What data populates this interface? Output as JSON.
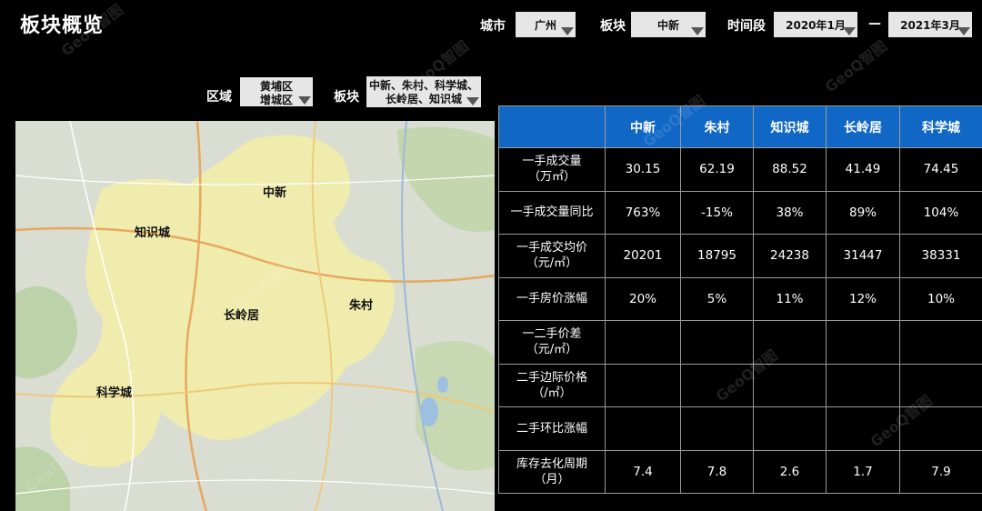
{
  "header": {
    "title": "板块概览"
  },
  "filters": {
    "city_label": "城市",
    "city_value": "广州",
    "sector_label": "板块",
    "sector_value": "中新",
    "period_label": "时间段",
    "period_start": "2020年1月",
    "period_sep": "—",
    "period_end": "2021年3月",
    "district_label": "区域",
    "district_value_line1": "黄埔区",
    "district_value_line2": "增城区",
    "sector2_label": "板块",
    "sector2_value_line1": "中新、朱村、科学城、",
    "sector2_value_line2": "长岭居、知识城"
  },
  "map": {
    "labels": [
      "中新",
      "知识城",
      "长岭居",
      "朱村",
      "科学城"
    ],
    "highlight_color": "#f2efa8"
  },
  "table": {
    "columns": [
      "",
      "中新",
      "朱村",
      "知识城",
      "长岭居",
      "科学城"
    ],
    "rows": [
      {
        "label_line1": "一手成交量",
        "label_line2": "（万㎡）",
        "values": [
          "30.15",
          "62.19",
          "88.52",
          "41.49",
          "74.45"
        ]
      },
      {
        "label_line1": "一手成交量同比",
        "label_line2": "",
        "values": [
          "763%",
          "-15%",
          "38%",
          "89%",
          "104%"
        ]
      },
      {
        "label_line1": "一手成交均价",
        "label_line2": "（元/㎡）",
        "values": [
          "20201",
          "18795",
          "24238",
          "31447",
          "38331"
        ]
      },
      {
        "label_line1": "一手房价涨幅",
        "label_line2": "",
        "values": [
          "20%",
          "5%",
          "11%",
          "12%",
          "10%"
        ]
      },
      {
        "label_line1": "一二手价差",
        "label_line2": "（元/㎡）",
        "values": [
          "",
          "",
          "",
          "",
          ""
        ]
      },
      {
        "label_line1": "二手边际价格",
        "label_line2": "（/㎡）",
        "values": [
          "",
          "",
          "",
          "",
          ""
        ]
      },
      {
        "label_line1": "二手环比涨幅",
        "label_line2": "",
        "values": [
          "",
          "",
          "",
          "",
          ""
        ]
      },
      {
        "label_line1": "库存去化周期",
        "label_line2": "（月）",
        "values": [
          "7.4",
          "7.8",
          "2.6",
          "1.7",
          "7.9"
        ]
      }
    ],
    "header_color": "#1067c6"
  }
}
